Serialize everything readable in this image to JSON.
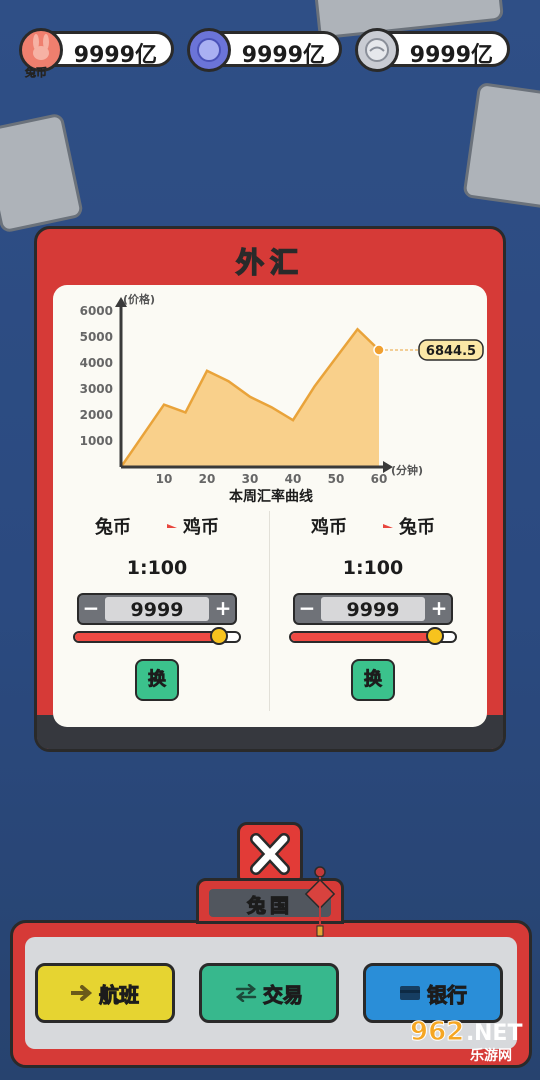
{
  "currencies": [
    {
      "icon": "rabbit-coin-icon",
      "value": "9999亿",
      "sublabel": "兔币",
      "color": "#ef7f6e"
    },
    {
      "icon": "blue-coin-icon",
      "value": "9999亿",
      "color": "#6b74d8"
    },
    {
      "icon": "silver-coin-icon",
      "value": "9999亿",
      "color": "#c9ccd3"
    }
  ],
  "panel": {
    "title": "外汇"
  },
  "chart_data": {
    "type": "area",
    "ylabel": "(价格)",
    "xlabel": "(分钟)",
    "title": "本周汇率曲线",
    "x": [
      0,
      5,
      10,
      15,
      20,
      25,
      30,
      35,
      40,
      45,
      50,
      55,
      60
    ],
    "y": [
      0,
      1200,
      2400,
      2100,
      3700,
      3300,
      2700,
      2300,
      1800,
      3100,
      4200,
      5300,
      4500
    ],
    "xticks": [
      10,
      20,
      30,
      40,
      50,
      60
    ],
    "yticks": [
      1000,
      2000,
      3000,
      4000,
      5000,
      6000
    ],
    "xlim": [
      0,
      60
    ],
    "ylim": [
      0,
      6000
    ],
    "current_value_label": "6844.5",
    "fill_color": "#f8c878",
    "line_color": "#e9a33a"
  },
  "exchange": [
    {
      "from": "兔币",
      "to": "鸡币",
      "ratio": "1:100",
      "amount": "9999",
      "slider": 0.88,
      "minus": "−",
      "plus": "+",
      "action": "换"
    },
    {
      "from": "鸡币",
      "to": "兔币",
      "ratio": "1:100",
      "amount": "9999",
      "slider": 0.88,
      "minus": "−",
      "plus": "+",
      "action": "换"
    }
  ],
  "close_icon": "close-x-icon",
  "location_tab": "兔国",
  "nav": [
    {
      "label": "航班",
      "icon": "plane-arrow-icon",
      "color": "#e6d431"
    },
    {
      "label": "交易",
      "icon": "swap-arrows-icon",
      "color": "#37b88d"
    },
    {
      "label": "银行",
      "icon": "card-icon",
      "color": "#2a8ed8"
    }
  ],
  "watermark": {
    "top": "962",
    "dot": ".",
    "suffix": "NET",
    "bottom": "乐游网"
  }
}
